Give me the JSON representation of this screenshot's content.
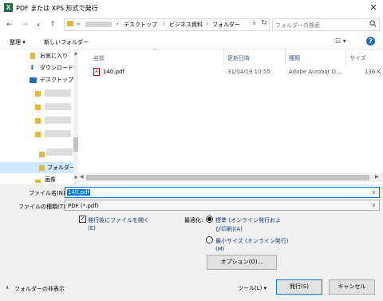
{
  "window": {
    "title": "PDF または XPS 形式で発行",
    "app_icon_letter": "X",
    "close_glyph": "✕"
  },
  "address": {
    "back_glyph": "←",
    "forward_glyph": "→",
    "recent_glyph": "∨",
    "up_glyph": "↑",
    "overflow": "«",
    "separator": "›",
    "crumbs": [
      "デスクトップ",
      "ビジネス資料",
      "フォルダー"
    ],
    "dropdown_glyph": "∨",
    "refresh_glyph": "↻"
  },
  "search": {
    "placeholder": "フォルダーの検索"
  },
  "toolbar": {
    "organize": "整理 ▾",
    "new_folder": "新しいフォルダー",
    "view_glyph": "☷ ▾",
    "help_glyph": "?"
  },
  "nav": {
    "favorites": "お気に入り",
    "downloads": "ダウンロード",
    "desktop": "デスクトップ",
    "selected_folder": "フォルダー",
    "last_item": "画像"
  },
  "columns": {
    "name": "名前",
    "date": "更新日時",
    "type": "種類",
    "size": "サイズ"
  },
  "files": [
    {
      "name": "140.pdf",
      "date": "31/04/19 10:55",
      "type": "Adobe Acrobat D...",
      "size": "136 K"
    }
  ],
  "form": {
    "filename_label": "ファイル名(N):",
    "filename_value": "140.pdf",
    "filetype_label": "ファイルの種類(T):",
    "filetype_value": "PDF (*.pdf)",
    "open_after_label_1": "発行後にファイルを開く",
    "open_after_label_2": "(E)",
    "open_after_checked": true,
    "optimize_label": "最適化:",
    "opt_standard_1": "標準 (オンライン発行およ",
    "opt_standard_2": "び印刷)(A)",
    "opt_min_1": "最小サイズ (オンライン発行)",
    "opt_min_2": "(M)",
    "options_button": "オプション(O)..."
  },
  "footer": {
    "hide_folders": "フォルダーの非表示",
    "tools": "ツール(L)  ▾",
    "publish": "発行(S)",
    "cancel": "キャンセル"
  },
  "colors": {
    "accent": "#0078d7",
    "folder": "#e8b73a",
    "selection": "#cde8ff"
  }
}
